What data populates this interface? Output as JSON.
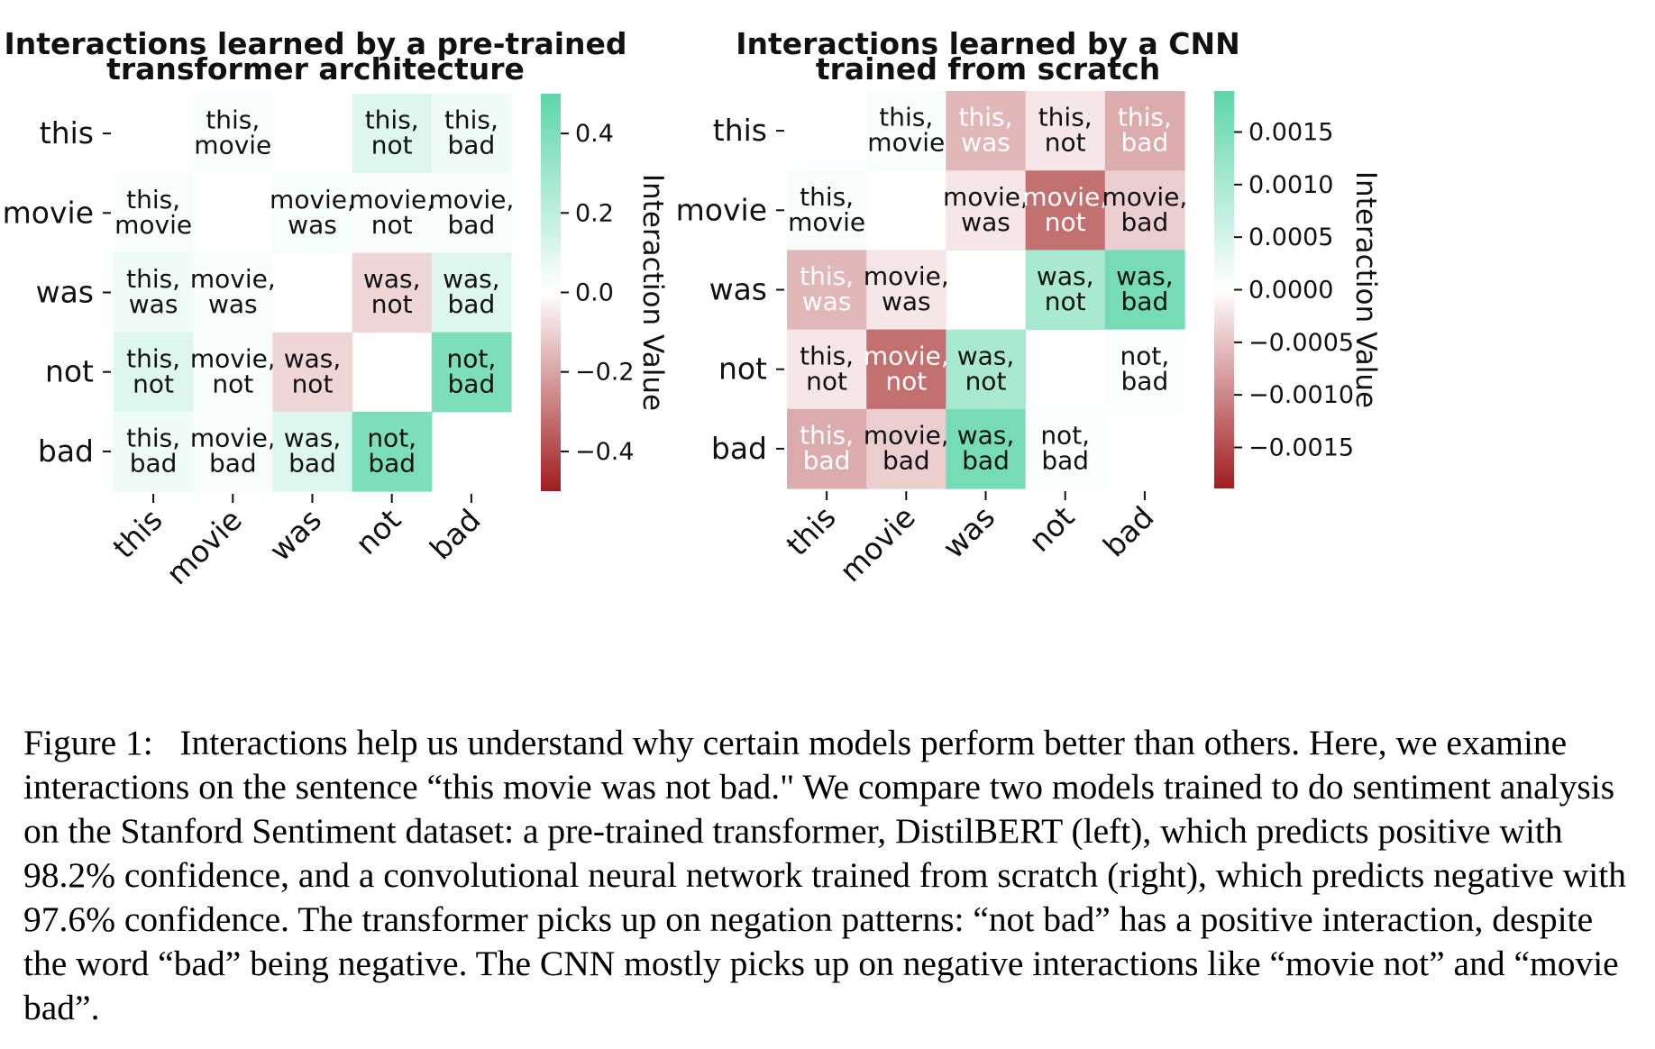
{
  "chart_data": [
    {
      "type": "heatmap",
      "title": "Interactions learned by a pre-trained transformer architecture",
      "title_lines": [
        "Interactions learned by a pre-trained",
        "transformer architecture"
      ],
      "x_categories": [
        "this",
        "movie",
        "was",
        "not",
        "bad"
      ],
      "y_categories": [
        "this",
        "movie",
        "was",
        "not",
        "bad"
      ],
      "values": [
        [
          null,
          0.02,
          null,
          0.1,
          0.05
        ],
        [
          0.02,
          null,
          0.03,
          0.02,
          0.02
        ],
        [
          0.05,
          0.02,
          null,
          -0.09,
          0.1
        ],
        [
          0.1,
          0.02,
          -0.09,
          null,
          0.4
        ],
        [
          0.05,
          0.02,
          0.1,
          0.4,
          null
        ]
      ],
      "cell_labels": [
        [
          null,
          "this,|movie",
          null,
          "this,|not",
          "this,|bad"
        ],
        [
          "this,|movie",
          null,
          "movie,|was",
          "movie,|not",
          "movie,|bad"
        ],
        [
          "this,|was",
          "movie,|was",
          null,
          "was,|not",
          "was,|bad"
        ],
        [
          "this,|not",
          "movie,|not",
          "was,|not",
          null,
          "not,|bad"
        ],
        [
          "this,|bad",
          "movie,|bad",
          "was,|bad",
          "not,|bad",
          null
        ]
      ],
      "colorbar": {
        "label": "Interaction Value",
        "vmin": -0.5,
        "vmax": 0.5,
        "ticks": [
          0.4,
          0.2,
          0.0,
          -0.2,
          -0.4
        ],
        "tick_labels": [
          "0.4",
          "0.2",
          "0.0",
          "−0.2",
          "−0.4"
        ]
      }
    },
    {
      "type": "heatmap",
      "title": "Interactions learned by a CNN trained from scratch",
      "title_lines": [
        "Interactions learned by a CNN",
        "trained from scratch"
      ],
      "x_categories": [
        "this",
        "movie",
        "was",
        "not",
        "bad"
      ],
      "y_categories": [
        "this",
        "movie",
        "was",
        "not",
        "bad"
      ],
      "values": [
        [
          null,
          0.0001,
          -0.0006,
          -0.0002,
          -0.0007
        ],
        [
          0.0001,
          null,
          -0.0002,
          -0.0012,
          -0.0004
        ],
        [
          -0.0006,
          -0.0002,
          null,
          0.001,
          0.0016
        ],
        [
          -0.0002,
          -0.0012,
          0.001,
          null,
          3e-05
        ],
        [
          -0.0007,
          -0.0004,
          0.0016,
          3e-05,
          null
        ]
      ],
      "cell_labels": [
        [
          null,
          "this,|movie",
          "this,|was",
          "this,|not",
          "this,|bad"
        ],
        [
          "this,|movie",
          null,
          "movie,|was",
          "movie,|not",
          "movie,|bad"
        ],
        [
          "this,|was",
          "movie,|was",
          null,
          "was,|not",
          "was,|bad"
        ],
        [
          "this,|not",
          "movie,|not",
          "was,|not",
          null,
          "not,|bad"
        ],
        [
          "this,|bad",
          "movie,|bad",
          "was,|bad",
          "not,|bad",
          null
        ]
      ],
      "colorbar": {
        "label": "Interaction Value",
        "vmin": -0.00189,
        "vmax": 0.00189,
        "ticks": [
          0.0015,
          0.001,
          0.0005,
          0.0,
          -0.0005,
          -0.001,
          -0.0015
        ],
        "tick_labels": [
          "0.0015",
          "0.0010",
          "0.0005",
          "0.0000",
          "−0.0005",
          "−0.0010",
          "−0.0015"
        ]
      }
    }
  ],
  "colors": {
    "positive": "#5cd6a9",
    "neutral": "#ffffff",
    "negative": "#a11d1f"
  },
  "caption": "Figure 1:  Interactions help us understand why certain models perform better than others. Here, we examine interactions on the sentence “this movie was not bad.\" We compare two models trained to do sentiment analysis on the Stanford Sentiment dataset: a pre-trained transformer, DistilBERT (left), which predicts positive with 98.2% confidence, and a convolutional neural network trained from scratch (right), which predicts negative with 97.6% confidence. The transformer picks up on negation patterns: “not bad” has a positive interaction, despite the word “bad” being negative. The CNN mostly picks up on negative interactions like “movie not” and “movie bad”."
}
